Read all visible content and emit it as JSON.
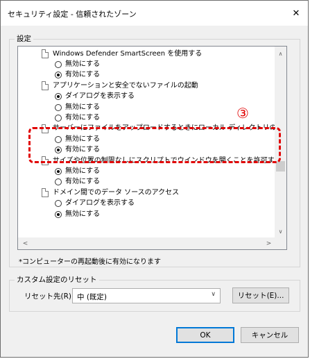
{
  "window": {
    "title": "セキュリティ設定 - 信頼されたゾーン",
    "close_glyph": "✕"
  },
  "settings_group": {
    "title": "設定",
    "items": [
      {
        "type": "category",
        "label": "Windows Defender SmartScreen を使用する"
      },
      {
        "type": "option",
        "label": "無効にする",
        "checked": false
      },
      {
        "type": "option",
        "label": "有効にする",
        "checked": true
      },
      {
        "type": "category",
        "label": "アプリケーションと安全でないファイルの起動"
      },
      {
        "type": "option",
        "label": "ダイアログを表示する",
        "checked": true
      },
      {
        "type": "option",
        "label": "無効にする",
        "checked": false
      },
      {
        "type": "option",
        "label": "有効にする",
        "checked": false
      },
      {
        "type": "category",
        "label": "サーバーにファイルをアップロードするときにローカル ディレクトリのパスを含める"
      },
      {
        "type": "option",
        "label": "無効にする",
        "checked": false
      },
      {
        "type": "option",
        "label": "有効にする",
        "checked": true
      },
      {
        "type": "category",
        "label": "サイズや位置の制限なしにスクリプトでウインドウを開くことを許可する"
      },
      {
        "type": "option",
        "label": "無効にする",
        "checked": true
      },
      {
        "type": "option",
        "label": "有効にする",
        "checked": false
      },
      {
        "type": "category",
        "label": "ドメイン間でのデータ ソースのアクセス"
      },
      {
        "type": "option",
        "label": "ダイアログを表示する",
        "checked": false
      },
      {
        "type": "option",
        "label": "無効にする",
        "checked": true
      }
    ],
    "scroll_up": "∧",
    "scroll_down": "∨",
    "scroll_left": "<",
    "scroll_right": ">"
  },
  "annotation": {
    "number": "③",
    "color": "#e10000"
  },
  "restart_note": "*コンピューターの再起動後に有効になります",
  "custom_reset": {
    "title": "カスタム設定のリセット",
    "reset_to_label": "リセット先(R):",
    "selected_value": "中 (既定)",
    "dropdown_arrow": "∨",
    "reset_button": "リセット(E)..."
  },
  "footer": {
    "ok": "OK",
    "cancel": "キャンセル"
  },
  "colors": {
    "default_button_border": "#0078d7",
    "dialog_bg": "#f0f0f0"
  }
}
